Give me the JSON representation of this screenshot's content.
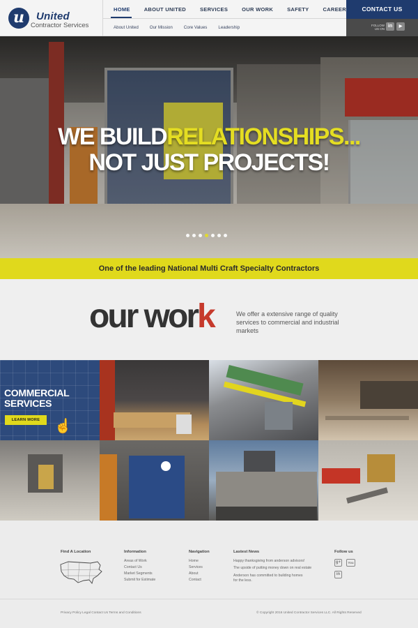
{
  "brand": {
    "logo_letter": "u",
    "name": "United",
    "subtitle": "Contractor Services",
    "primary_color": "#1f3b6e",
    "accent_color": "#e0d91c"
  },
  "nav": {
    "items": [
      "HOME",
      "ABOUT UNITED",
      "SERVICES",
      "OUR WORK",
      "SAFETY",
      "CAREERS"
    ],
    "active": "HOME",
    "sub_items": [
      "About United",
      "Our Mission",
      "Core Values",
      "Leadership"
    ]
  },
  "contact": {
    "button_label": "CONTACT US",
    "follow_label_1": "FOLLOW",
    "follow_label_2": "US ON",
    "social_icons": [
      "linkedin-icon",
      "youtube-icon"
    ],
    "linkedin_glyph": "in",
    "youtube_glyph": "▶"
  },
  "hero": {
    "line1_white": "WE BUILD ",
    "line1_highlight": "RELATIONSHIPS...",
    "line2": "NOT JUST PROJECTS!",
    "slide_count": 7,
    "active_slide": 4
  },
  "banner": {
    "text": "One of the leading National Multi Craft Specialty Contractors"
  },
  "our_work": {
    "title_a": "our ",
    "title_b": "wor",
    "title_c": "k",
    "description": "We offer a extensive range of quality services to commercial and industrial markets"
  },
  "grid": {
    "featured_title_1": "COMMERCIAL",
    "featured_title_2": "SERVICES",
    "learn_more": "LEARN MORE",
    "cursor_glyph": "☝"
  },
  "footer": {
    "find_location": "Find A Location",
    "information": {
      "heading": "Information",
      "items": [
        "Areas of Work",
        "Contact Us",
        "Market Segments",
        "Submit for Estimate"
      ]
    },
    "navigation": {
      "heading": "Navigation",
      "items": [
        "Home",
        "Services",
        "About",
        "Contact"
      ]
    },
    "news": {
      "heading": "Lastest News",
      "items": [
        "Happy thanksgiving from anderson advisors!",
        "The upside of putting money down on real estate",
        "Anderson has committed to building homes",
        "for the less."
      ]
    },
    "follow": {
      "heading": "Follow us",
      "googleplus_glyph": "g+",
      "youtube_glyph": "You",
      "linkedin_glyph": "in"
    },
    "bottom_links": "Privacy Policy  Legal  Contact Us  Terms and Conditions",
    "copyright": "© Copyright 2016 United Contractor Services LLC. All Rights Reserved"
  }
}
